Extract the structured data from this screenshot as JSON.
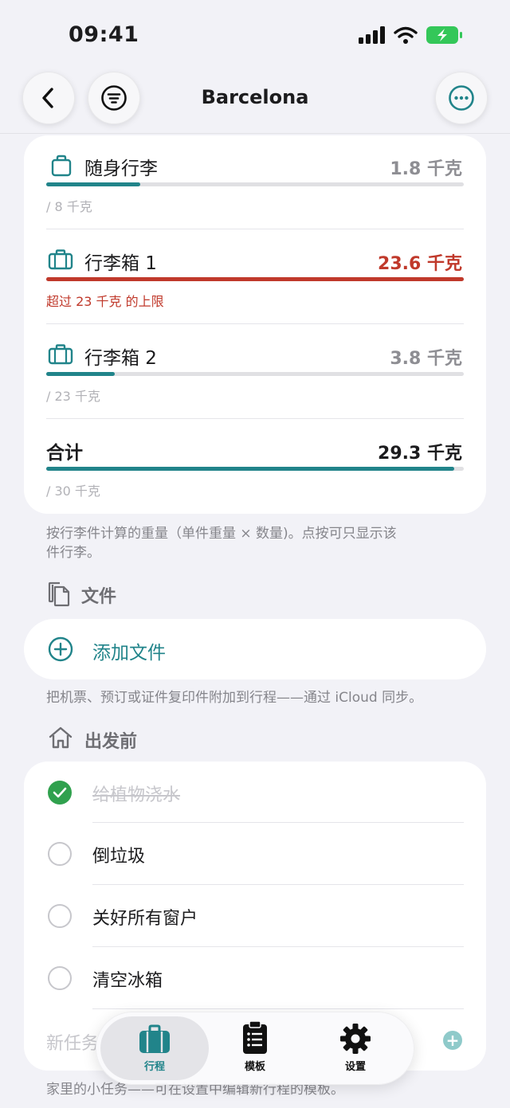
{
  "status_bar": {
    "time": "09:41"
  },
  "nav": {
    "title": "Barcelona"
  },
  "luggage": {
    "items": [
      {
        "name": "随身行李",
        "weight": "1.8 千克",
        "limit_note": "/ 8 千克",
        "fill": 0.225,
        "over": false
      },
      {
        "name": "行李箱 1",
        "weight": "23.6 千克",
        "limit_note": "超过 23 千克 的上限",
        "fill": 1.0,
        "over": true
      },
      {
        "name": "行李箱 2",
        "weight": "3.8 千克",
        "limit_note": "/ 23 千克",
        "fill": 0.165,
        "over": false
      }
    ],
    "total": {
      "name": "合计",
      "weight": "29.3 千克",
      "limit_note": "/ 30 千克",
      "fill": 0.977
    },
    "footnote_line1": "按行李件计算的重量（单件重量 × 数量)。点按可只显示该",
    "footnote_line2": "件行李。"
  },
  "documents": {
    "header": "文件",
    "add_label": "添加文件",
    "footnote": "把机票、预订或证件复印件附加到行程——通过 iCloud 同步。"
  },
  "before_departure": {
    "header": "出发前",
    "tasks": [
      {
        "label": "给植物浇水",
        "done": true
      },
      {
        "label": "倒垃圾",
        "done": false
      },
      {
        "label": "关好所有窗户",
        "done": false
      },
      {
        "label": "清空冰箱",
        "done": false
      }
    ],
    "new_task_placeholder": "新任务",
    "footnote": "家里的小任务——可在设置中编辑新行程的模板。"
  },
  "tabbar": {
    "tabs": [
      {
        "label": "行程",
        "active": true
      },
      {
        "label": "模板",
        "active": false
      },
      {
        "label": "设置",
        "active": false
      }
    ]
  },
  "colors": {
    "accent": "#21848a",
    "danger": "#c0392b",
    "check": "#30a14e",
    "background": "#f2f2f7"
  },
  "icons": {
    "back": "chevron-left-icon",
    "filter": "filter-icon",
    "more": "ellipsis-icon",
    "carry_on": "bag-icon",
    "suitcase": "suitcase-icon",
    "docs": "documents-icon",
    "home": "house-icon",
    "add": "plus-circle-icon"
  }
}
